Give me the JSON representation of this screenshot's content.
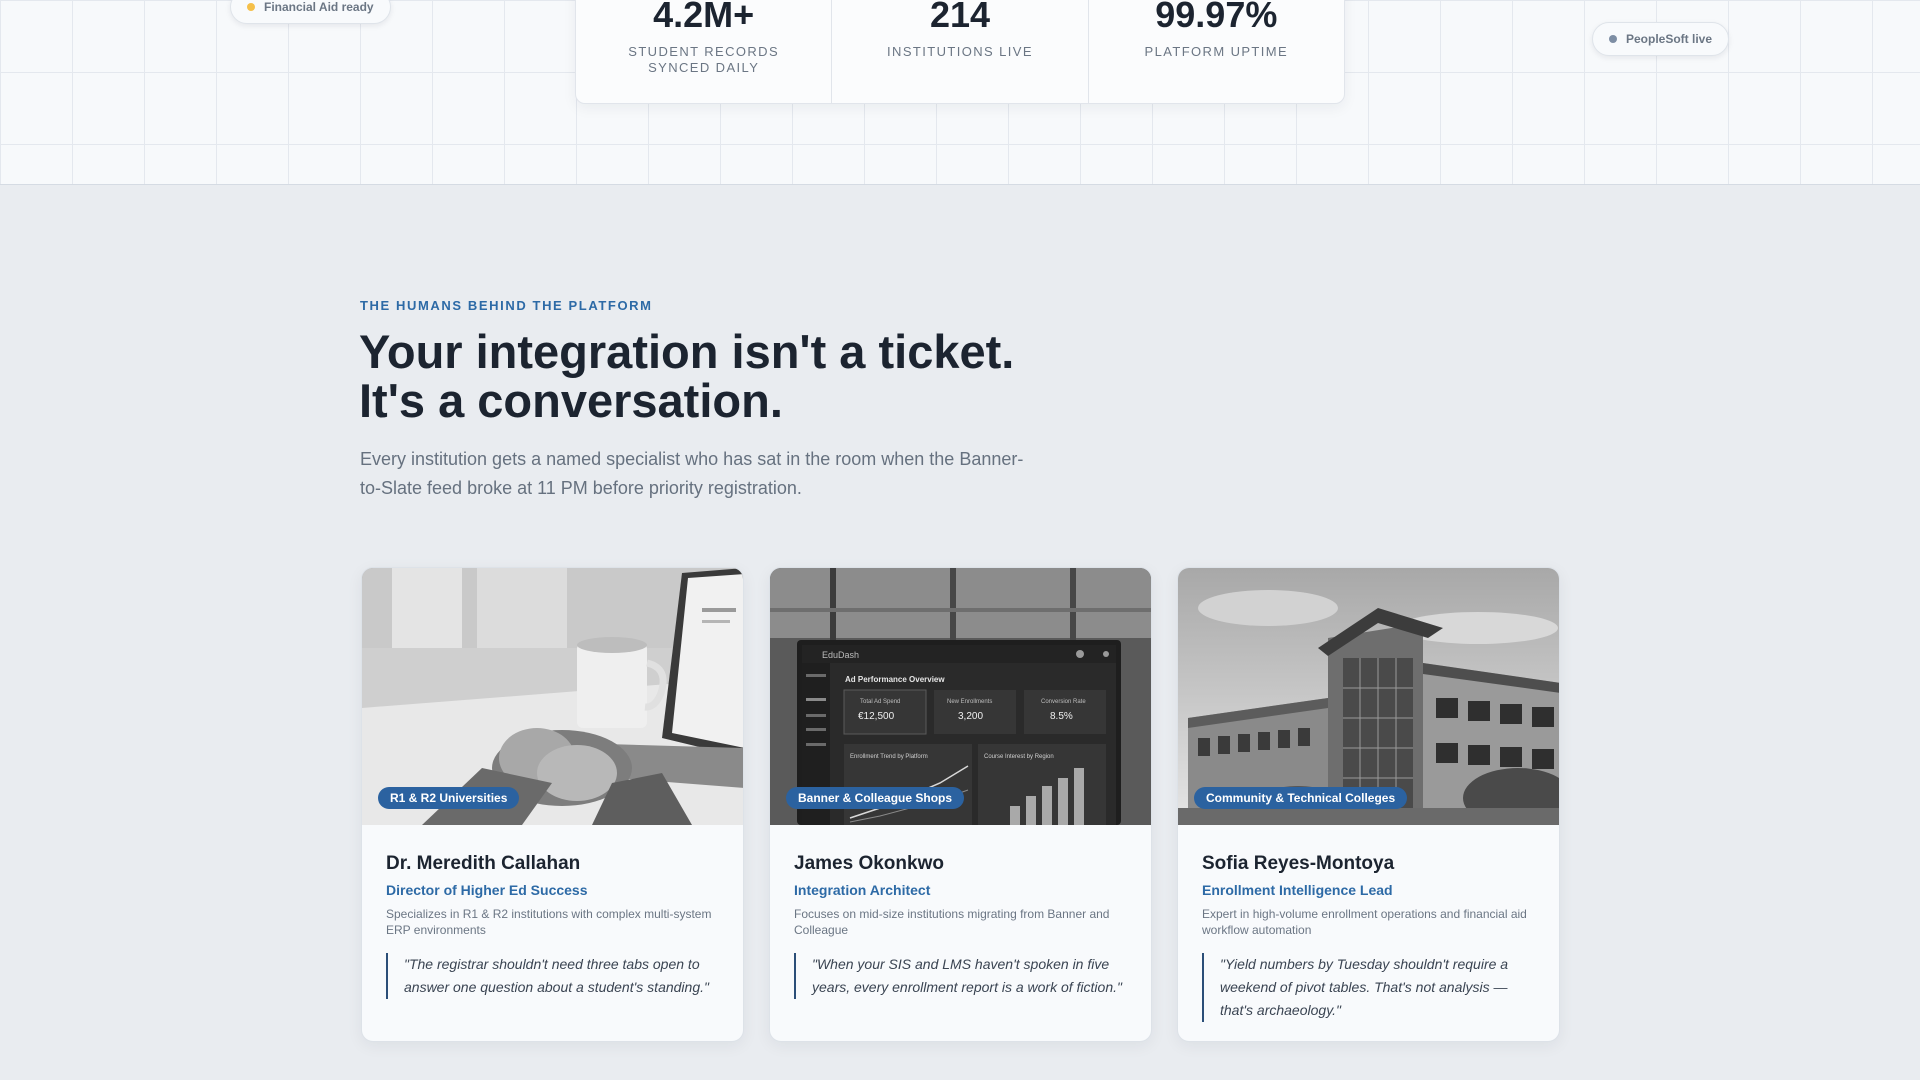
{
  "hero": {
    "pills": {
      "financial_aid": "Financial Aid ready",
      "peoplesoft": "PeopleSoft live"
    },
    "stats": [
      {
        "value": "4.2M+",
        "label": "STUDENT RECORDS SYNCED DAILY"
      },
      {
        "value": "214",
        "label": "INSTITUTIONS LIVE"
      },
      {
        "value": "99.97%",
        "label": "PLATFORM UPTIME"
      }
    ]
  },
  "section": {
    "eyebrow": "THE HUMANS BEHIND THE PLATFORM",
    "headline_line1": "Your integration isn't a ticket.",
    "headline_line2": "It's a conversation.",
    "subtext": "Every institution gets a named specialist who has sat in the room when the Banner-to-Slate feed broke at 11 PM before priority registration."
  },
  "team": [
    {
      "tag": "R1 & R2 Universities",
      "name": "Dr. Meredith Callahan",
      "role": "Director of Higher Ed Success",
      "description": "Specializes in R1 & R2 institutions with complex multi-system ERP environments",
      "quote": "\"The registrar shouldn't need three tabs open to answer one question about a student's standing.\""
    },
    {
      "tag": "Banner & Colleague Shops",
      "name": "James Okonkwo",
      "role": "Integration Architect",
      "description": "Focuses on mid-size institutions migrating from Banner and Colleague",
      "quote": "\"When your SIS and LMS haven't spoken in five years, every enrollment report is a work of fiction.\""
    },
    {
      "tag": "Community & Technical Colleges",
      "name": "Sofia Reyes-Montoya",
      "role": "Enrollment Intelligence Lead",
      "description": "Expert in high-volume enrollment operations and financial aid workflow automation",
      "quote": "\"Yield numbers by Tuesday shouldn't require a weekend of pivot tables. That's not analysis — that's archaeology.\""
    }
  ],
  "dashboard_photo": {
    "app_name": "EduDash",
    "title": "Ad Performance Overview",
    "kpis": [
      {
        "label": "Total Ad Spend",
        "value": "€12,500"
      },
      {
        "label": "New Enrollments",
        "value": "3,200"
      },
      {
        "label": "Conversion Rate",
        "value": "8.5%"
      }
    ],
    "panel1": "Enrollment Trend by Platform",
    "panel2": "Course Interest by Region"
  },
  "colors": {
    "accent": "#2d6aa6",
    "tag_bg": "#2b62a0",
    "financial_aid_dot": "#f5c04a",
    "peoplesoft_dot": "#7d8ea4"
  }
}
